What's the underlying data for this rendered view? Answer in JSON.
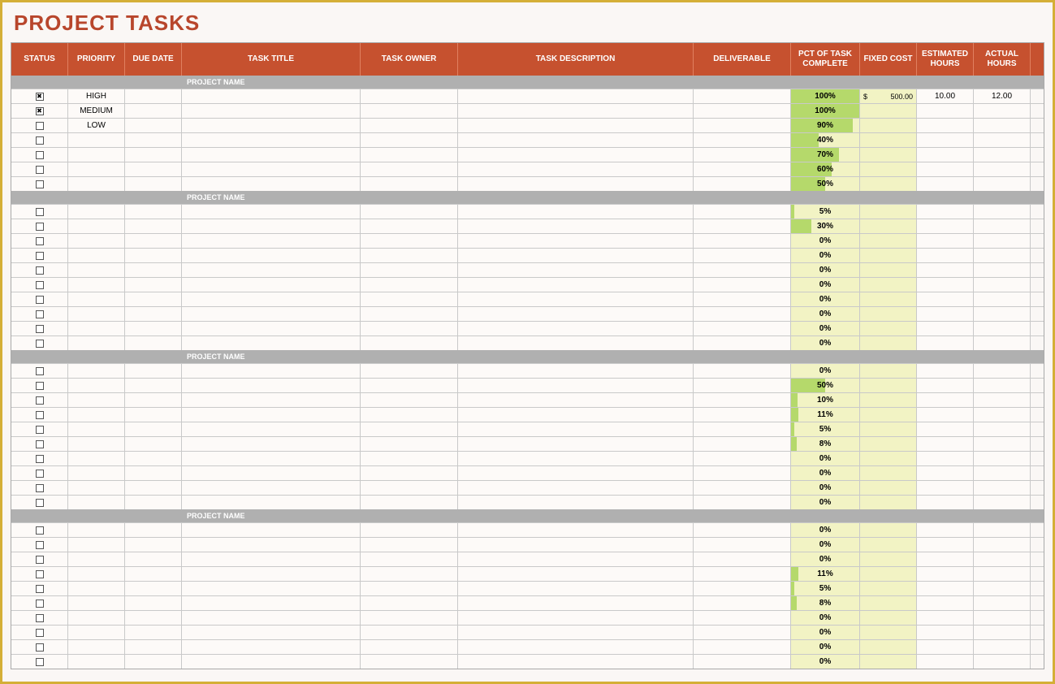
{
  "title": "PROJECT TASKS",
  "columns": {
    "status": "STATUS",
    "priority": "PRIORITY",
    "duedate": "DUE DATE",
    "title": "TASK TITLE",
    "owner": "TASK OWNER",
    "desc": "TASK DESCRIPTION",
    "deliv": "DELIVERABLE",
    "pct": "PCT OF TASK COMPLETE",
    "fixed": "FIXED COST",
    "est": "ESTIMATED HOURS",
    "act": "ACTUAL HOURS"
  },
  "section_label": "PROJECT NAME",
  "sections": [
    {
      "rows": [
        {
          "checked": true,
          "priority": "HIGH",
          "pct": 100,
          "fixed_sym": "$",
          "fixed_val": "500.00",
          "est": "10.00",
          "act": "12.00"
        },
        {
          "checked": true,
          "priority": "MEDIUM",
          "pct": 100
        },
        {
          "checked": false,
          "priority": "LOW",
          "pct": 90
        },
        {
          "checked": false,
          "pct": 40
        },
        {
          "checked": false,
          "pct": 70
        },
        {
          "checked": false,
          "pct": 60
        },
        {
          "checked": false,
          "pct": 50
        }
      ]
    },
    {
      "rows": [
        {
          "checked": false,
          "pct": 5
        },
        {
          "checked": false,
          "pct": 30
        },
        {
          "checked": false,
          "pct": 0
        },
        {
          "checked": false,
          "pct": 0
        },
        {
          "checked": false,
          "pct": 0
        },
        {
          "checked": false,
          "pct": 0
        },
        {
          "checked": false,
          "pct": 0
        },
        {
          "checked": false,
          "pct": 0
        },
        {
          "checked": false,
          "pct": 0
        },
        {
          "checked": false,
          "pct": 0
        }
      ]
    },
    {
      "rows": [
        {
          "checked": false,
          "pct": 0
        },
        {
          "checked": false,
          "pct": 50
        },
        {
          "checked": false,
          "pct": 10
        },
        {
          "checked": false,
          "pct": 11
        },
        {
          "checked": false,
          "pct": 5
        },
        {
          "checked": false,
          "pct": 8
        },
        {
          "checked": false,
          "pct": 0
        },
        {
          "checked": false,
          "pct": 0
        },
        {
          "checked": false,
          "pct": 0
        },
        {
          "checked": false,
          "pct": 0
        }
      ]
    },
    {
      "rows": [
        {
          "checked": false,
          "pct": 0
        },
        {
          "checked": false,
          "pct": 0
        },
        {
          "checked": false,
          "pct": 0
        },
        {
          "checked": false,
          "pct": 11
        },
        {
          "checked": false,
          "pct": 5
        },
        {
          "checked": false,
          "pct": 8
        },
        {
          "checked": false,
          "pct": 0
        },
        {
          "checked": false,
          "pct": 0
        },
        {
          "checked": false,
          "pct": 0
        },
        {
          "checked": false,
          "pct": 0
        }
      ]
    }
  ]
}
